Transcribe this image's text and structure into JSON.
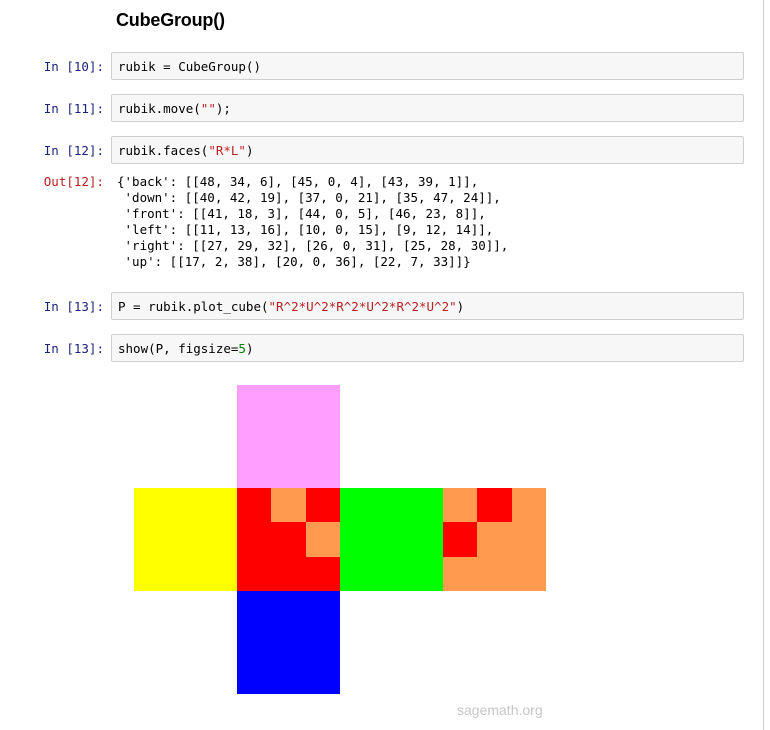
{
  "notebook": {
    "title": "CubeGroup()",
    "cells": [
      {
        "id": "cell-10",
        "prompt": "In [10]:",
        "code": [
          {
            "t": "rubik = CubeGroup()"
          }
        ]
      },
      {
        "id": "cell-11",
        "prompt": "In [11]:",
        "code": [
          {
            "t": "rubik.move("
          },
          {
            "t": "\"\"",
            "c": "str"
          },
          {
            "t": ");"
          }
        ]
      },
      {
        "id": "cell-12",
        "prompt": "In [12]:",
        "code": [
          {
            "t": "rubik.faces("
          },
          {
            "t": "\"R*L\"",
            "c": "str"
          },
          {
            "t": ")"
          }
        ]
      },
      {
        "id": "cell-13a",
        "prompt": "In [13]:",
        "code": [
          {
            "t": "P = rubik.plot_cube("
          },
          {
            "t": "\"R^2*U^2*R^2*U^2*R^2*U^2\"",
            "c": "str"
          },
          {
            "t": ")"
          }
        ]
      },
      {
        "id": "cell-13b",
        "prompt": "In [13]:",
        "code": [
          {
            "t": "show(P, figsize="
          },
          {
            "t": "5",
            "c": "num"
          },
          {
            "t": ")"
          }
        ]
      }
    ],
    "output_12": {
      "prompt": "Out[12]:",
      "text": "{'back': [[48, 34, 6], [45, 0, 4], [43, 39, 1]],\n 'down': [[40, 42, 19], [37, 0, 21], [35, 47, 24]],\n 'front': [[41, 18, 3], [44, 0, 5], [46, 23, 8]],\n 'left': [[11, 13, 16], [10, 0, 15], [9, 12, 14]],\n 'right': [[27, 29, 32], [26, 0, 31], [25, 28, 30]],\n 'up': [[17, 2, 38], [20, 0, 36], [22, 7, 33]]}"
    }
  },
  "colors": {
    "pink": "#ff9eff",
    "yellow": "#ffff00",
    "red": "#ff0000",
    "orange": "#ff9a4e",
    "green": "#00ff00",
    "blue": "#0000ff"
  },
  "cube_net": [
    {
      "face": "up",
      "col": 1,
      "row": 0,
      "stickers": [
        "pink",
        "pink",
        "pink",
        "pink",
        "pink",
        "pink",
        "pink",
        "pink",
        "pink"
      ]
    },
    {
      "face": "left",
      "col": 0,
      "row": 1,
      "stickers": [
        "yellow",
        "yellow",
        "yellow",
        "yellow",
        "yellow",
        "yellow",
        "yellow",
        "yellow",
        "yellow"
      ]
    },
    {
      "face": "front",
      "col": 1,
      "row": 1,
      "stickers": [
        "red",
        "orange",
        "red",
        "red",
        "red",
        "orange",
        "red",
        "red",
        "red"
      ]
    },
    {
      "face": "right",
      "col": 2,
      "row": 1,
      "stickers": [
        "green",
        "green",
        "green",
        "green",
        "green",
        "green",
        "green",
        "green",
        "green"
      ]
    },
    {
      "face": "back",
      "col": 3,
      "row": 1,
      "stickers": [
        "orange",
        "red",
        "orange",
        "red",
        "orange",
        "orange",
        "orange",
        "orange",
        "orange"
      ]
    },
    {
      "face": "down",
      "col": 1,
      "row": 2,
      "stickers": [
        "blue",
        "blue",
        "blue",
        "blue",
        "blue",
        "blue",
        "blue",
        "blue",
        "blue"
      ]
    }
  ],
  "watermark": "sagemath.org"
}
